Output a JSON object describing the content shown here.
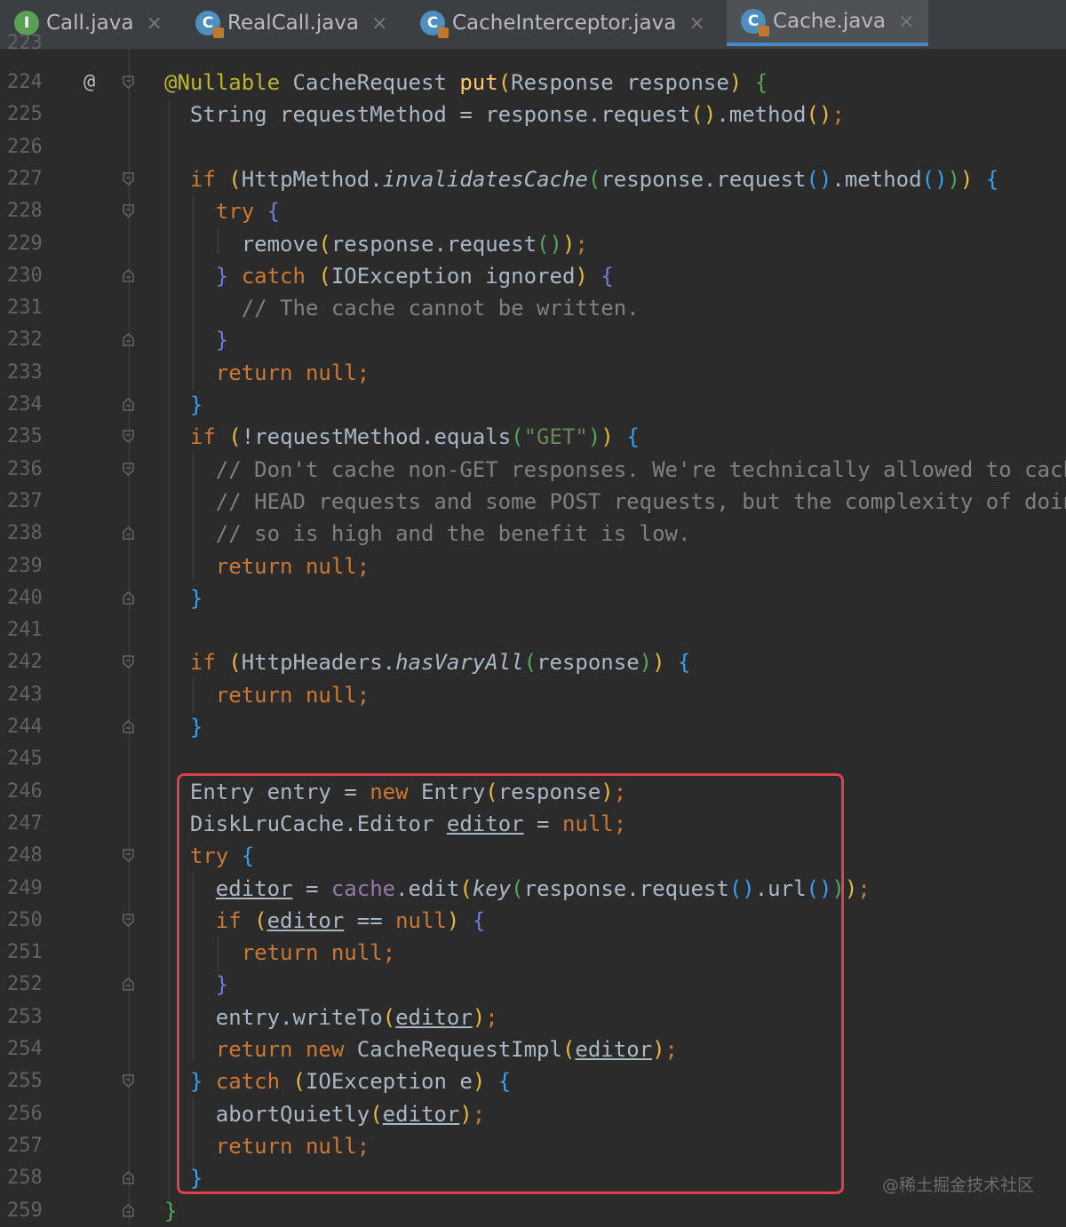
{
  "tabs": [
    {
      "label": "Call.java",
      "icon": "I",
      "icon_name": "interface-icon"
    },
    {
      "label": "RealCall.java",
      "icon": "C",
      "icon_name": "class-icon"
    },
    {
      "label": "CacheInterceptor.java",
      "icon": "C",
      "icon_name": "class-icon"
    },
    {
      "label": "Cache.java",
      "icon": "C",
      "icon_name": "class-icon",
      "active": true
    }
  ],
  "gutter": {
    "override_marker": "@",
    "partial_line_number": "223"
  },
  "line_numbers": [
    "224",
    "225",
    "226",
    "227",
    "228",
    "229",
    "230",
    "231",
    "232",
    "233",
    "234",
    "235",
    "236",
    "237",
    "238",
    "239",
    "240",
    "241",
    "242",
    "243",
    "244",
    "245",
    "246",
    "247",
    "248",
    "249",
    "250",
    "251",
    "252",
    "253",
    "254",
    "255",
    "256",
    "257",
    "258",
    "259"
  ],
  "code_lines": [
    "@Nullable CacheRequest put(Response response) {",
    "  String requestMethod = response.request().method();",
    "",
    "  if (HttpMethod.invalidatesCache(response.request().method())) {",
    "    try {",
    "      remove(response.request());",
    "    } catch (IOException ignored) {",
    "      // The cache cannot be written.",
    "    }",
    "    return null;",
    "  }",
    "  if (!requestMethod.equals(\"GET\")) {",
    "    // Don't cache non-GET responses. We're technically allowed to cache",
    "    // HEAD requests and some POST requests, but the complexity of doing",
    "    // so is high and the benefit is low.",
    "    return null;",
    "  }",
    "",
    "  if (HttpHeaders.hasVaryAll(response)) {",
    "    return null;",
    "  }",
    "",
    "  Entry entry = new Entry(response);",
    "  DiskLruCache.Editor editor = null;",
    "  try {",
    "    editor = cache.edit(key(response.request().url()));",
    "    if (editor == null) {",
    "      return null;",
    "    }",
    "    entry.writeTo(editor);",
    "    return new CacheRequestImpl(editor);",
    "  } catch (IOException e) {",
    "    abortQuietly(editor);",
    "    return null;",
    "  }",
    "}"
  ],
  "highlight": {
    "label": "highlighted code region",
    "color": "#e0404a"
  },
  "watermark": "@稀土掘金技术社区",
  "colors": {
    "background": "#2b2b2b",
    "keyword": "#cc7832",
    "method": "#ffc66d",
    "string": "#6a8759",
    "comment": "#808080",
    "field": "#9876aa",
    "annotation": "#bbb529",
    "active_tab_underline": "#4a88c7"
  }
}
